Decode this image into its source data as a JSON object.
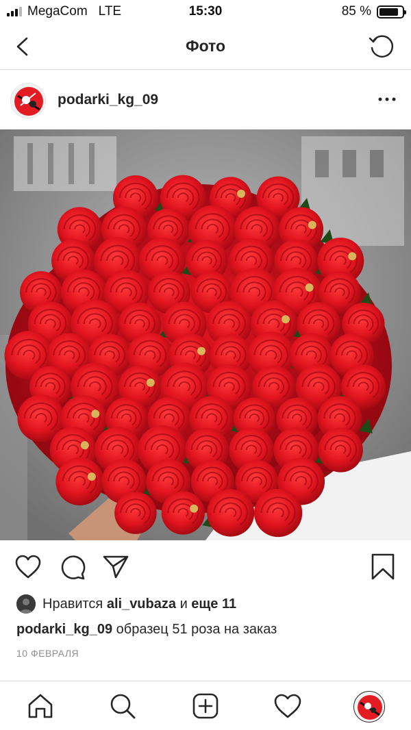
{
  "status_bar": {
    "carrier": "MegaCom",
    "network": "LTE",
    "time": "15:30",
    "battery_text": "85 %",
    "battery_level": 0.85
  },
  "nav": {
    "title": "Фото",
    "back_icon": "chevron-left-icon",
    "refresh_icon": "refresh-icon"
  },
  "post": {
    "username": "podarki_kg_09",
    "more_icon": "more-dots-icon",
    "image_alt_desc": "bouquet of red paper roses",
    "likes": {
      "prefix": "Нравится",
      "user": "ali_vubaza",
      "conjunction": "и",
      "others": "еще 11"
    },
    "caption": {
      "username": "podarki_kg_09",
      "text": "образец 51 роза на заказ"
    },
    "date": "10 ФЕВРАЛЯ"
  },
  "actions": {
    "like_icon": "heart-icon",
    "comment_icon": "comment-icon",
    "share_icon": "send-icon",
    "save_icon": "bookmark-icon"
  },
  "tab_bar": {
    "items": [
      "home-icon",
      "search-icon",
      "add-post-icon",
      "activity-heart-icon",
      "profile-avatar"
    ]
  },
  "colors": {
    "rose": "#e0141f",
    "leaf": "#1f4a18",
    "divider": "#dbdbdb",
    "muted": "#8e8e8e"
  }
}
